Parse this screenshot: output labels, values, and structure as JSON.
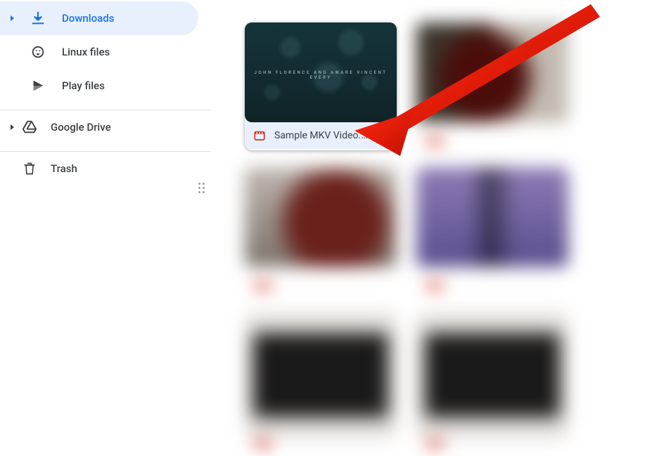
{
  "sidebar": {
    "items": [
      {
        "label": "Downloads"
      },
      {
        "label": "Linux files"
      },
      {
        "label": "Play files"
      }
    ],
    "drive_label": "Google Drive",
    "trash_label": "Trash"
  },
  "files": {
    "selected": {
      "name": "Sample MKV Video.…",
      "thumb_text": "JOHN FLORENCE AND AWARE VINCENT EVERY"
    }
  },
  "annotation": {
    "type": "arrow",
    "color": "#d91c0b",
    "target": "selected-file"
  }
}
